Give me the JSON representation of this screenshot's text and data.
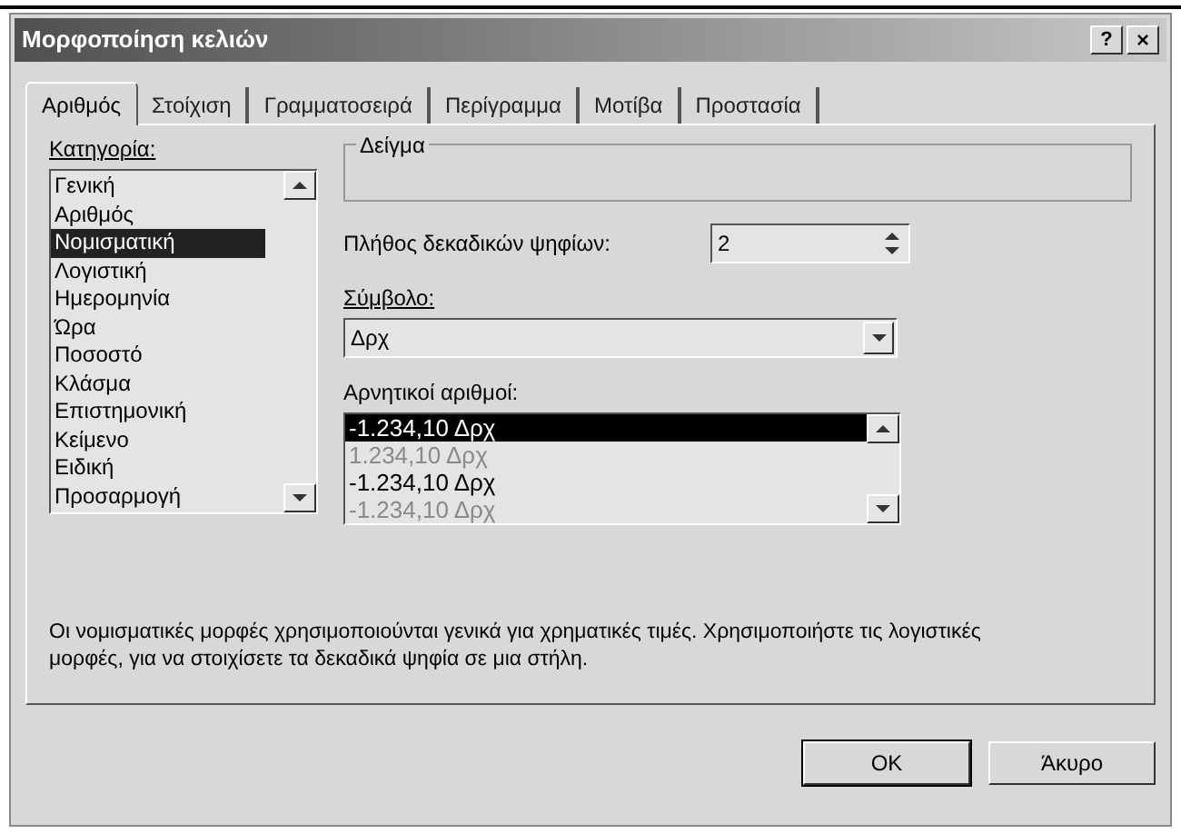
{
  "window": {
    "title": "Μορφοποίηση κελιών",
    "help_button": "?",
    "close_button": "×"
  },
  "tabs": [
    {
      "label": "Αριθμός",
      "selected": true
    },
    {
      "label": "Στοίχιση",
      "selected": false
    },
    {
      "label": "Γραμματοσειρά",
      "selected": false
    },
    {
      "label": "Περίγραμμα",
      "selected": false
    },
    {
      "label": "Μοτίβα",
      "selected": false
    },
    {
      "label": "Προστασία",
      "selected": false
    }
  ],
  "category": {
    "label": "Κατηγορία:",
    "items": [
      {
        "label": "Γενική",
        "selected": false
      },
      {
        "label": "Αριθμός",
        "selected": false
      },
      {
        "label": "Νομισματική",
        "selected": true
      },
      {
        "label": "Λογιστική",
        "selected": false
      },
      {
        "label": "Ημερομηνία",
        "selected": false
      },
      {
        "label": "Ώρα",
        "selected": false
      },
      {
        "label": "Ποσοστό",
        "selected": false
      },
      {
        "label": "Κλάσμα",
        "selected": false
      },
      {
        "label": "Επιστημονική",
        "selected": false
      },
      {
        "label": "Κείμενο",
        "selected": false
      },
      {
        "label": "Ειδική",
        "selected": false
      },
      {
        "label": "Προσαρμογή",
        "selected": false
      }
    ]
  },
  "sample": {
    "label": "Δείγμα"
  },
  "decimal_places": {
    "label": "Πλήθος δεκαδικών ψηφίων:",
    "value": "2"
  },
  "symbol": {
    "label": "Σύμβολο:",
    "value": "Δρχ"
  },
  "negative_numbers": {
    "label": "Αρνητικοί αριθμοί:",
    "items": [
      {
        "label": "-1.234,10 Δρχ",
        "selected": true,
        "color": "#000000"
      },
      {
        "label": "1.234,10 Δρχ",
        "selected": false,
        "color": "#8a8a8a"
      },
      {
        "label": "-1.234,10 Δρχ",
        "selected": false,
        "color": "#000000"
      },
      {
        "label": "-1.234,10 Δρχ",
        "selected": false,
        "color": "#8a8a8a"
      }
    ]
  },
  "description": "Οι νομισματικές μορφές χρησιμοποιούνται γενικά για χρηματικές τιμές. Χρησιμοποιήστε τις λογιστικές μορφές, για να στοιχίσετε τα δεκαδικά ψηφία σε μια στήλη.",
  "buttons": [
    {
      "label": "OK",
      "default": true
    },
    {
      "label": "Άκυρο",
      "default": false
    }
  ]
}
